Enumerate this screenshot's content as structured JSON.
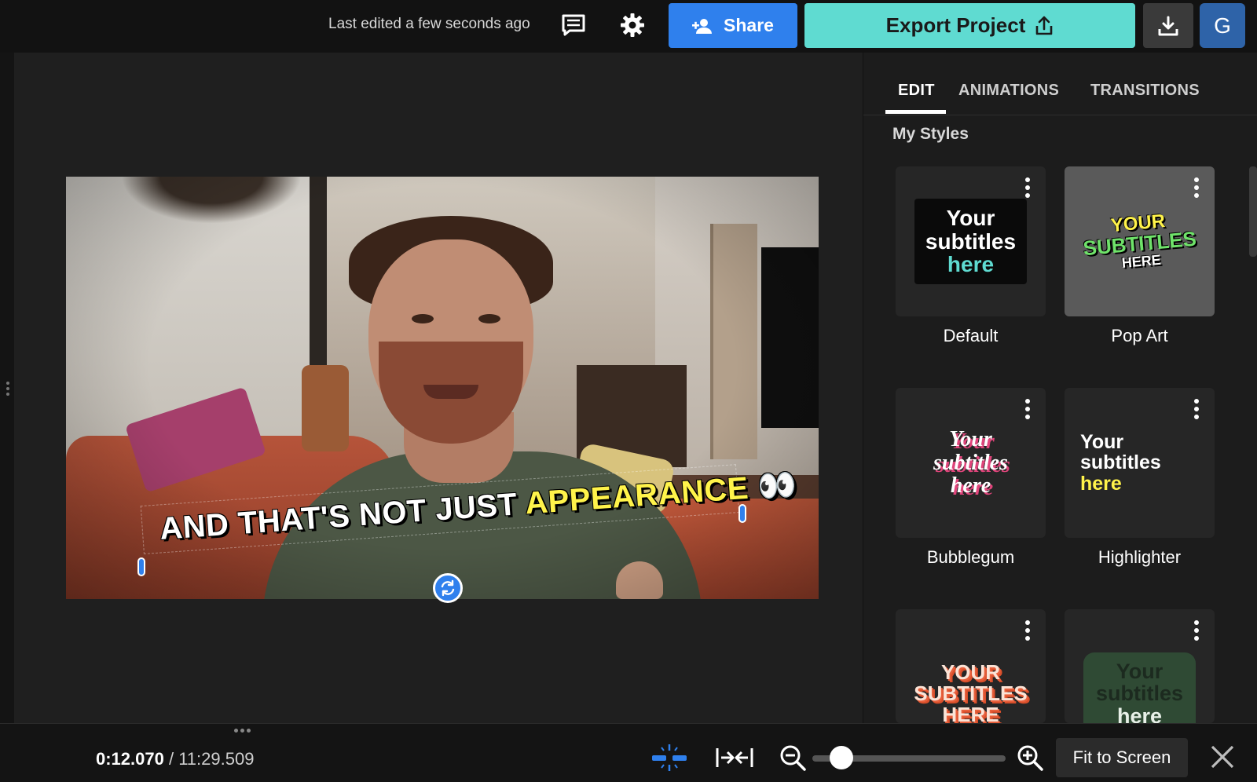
{
  "header": {
    "last_edited": "Last edited a few seconds ago",
    "comments_icon": "comments-icon",
    "settings_icon": "gear-icon",
    "share_label": "Share",
    "export_label": "Export Project",
    "download_icon": "download-icon",
    "avatar_initial": "G"
  },
  "video": {
    "subtitle_prefix": "AND THAT'S NOT JUST ",
    "subtitle_highlight": "APPEARANCE",
    "subtitle_emoji": "👀"
  },
  "panel": {
    "tabs": [
      {
        "label": "EDIT",
        "active": true
      },
      {
        "label": "ANIMATIONS",
        "active": false
      },
      {
        "label": "TRANSITIONS",
        "active": false
      }
    ],
    "section_title": "My Styles",
    "styles": [
      {
        "name": "Default",
        "preview": [
          "Your",
          "subtitles",
          "here"
        ],
        "selected": false
      },
      {
        "name": "Pop Art",
        "preview": [
          "YOUR",
          "SUBTITLES",
          "HERE"
        ],
        "selected": true
      },
      {
        "name": "Bubblegum",
        "preview": [
          "Your",
          "subtitles",
          "here"
        ],
        "selected": false
      },
      {
        "name": "Highlighter",
        "preview": [
          "Your",
          "subtitles",
          "here"
        ],
        "selected": false
      },
      {
        "name": "",
        "preview": [
          "YOUR",
          "SUBTITLES",
          "HERE"
        ],
        "selected": false
      },
      {
        "name": "",
        "preview": [
          "Your",
          "subtitles",
          "here"
        ],
        "selected": false
      }
    ]
  },
  "bottom": {
    "current_time": "0:12.070",
    "separator": " / ",
    "total_time": "11:29.509",
    "fit_label": "Fit to Screen"
  },
  "colors": {
    "share": "#2f80ed",
    "export": "#5fdbd1",
    "highlight_yellow": "#fff34a",
    "teal_text": "#5fdbd1"
  }
}
